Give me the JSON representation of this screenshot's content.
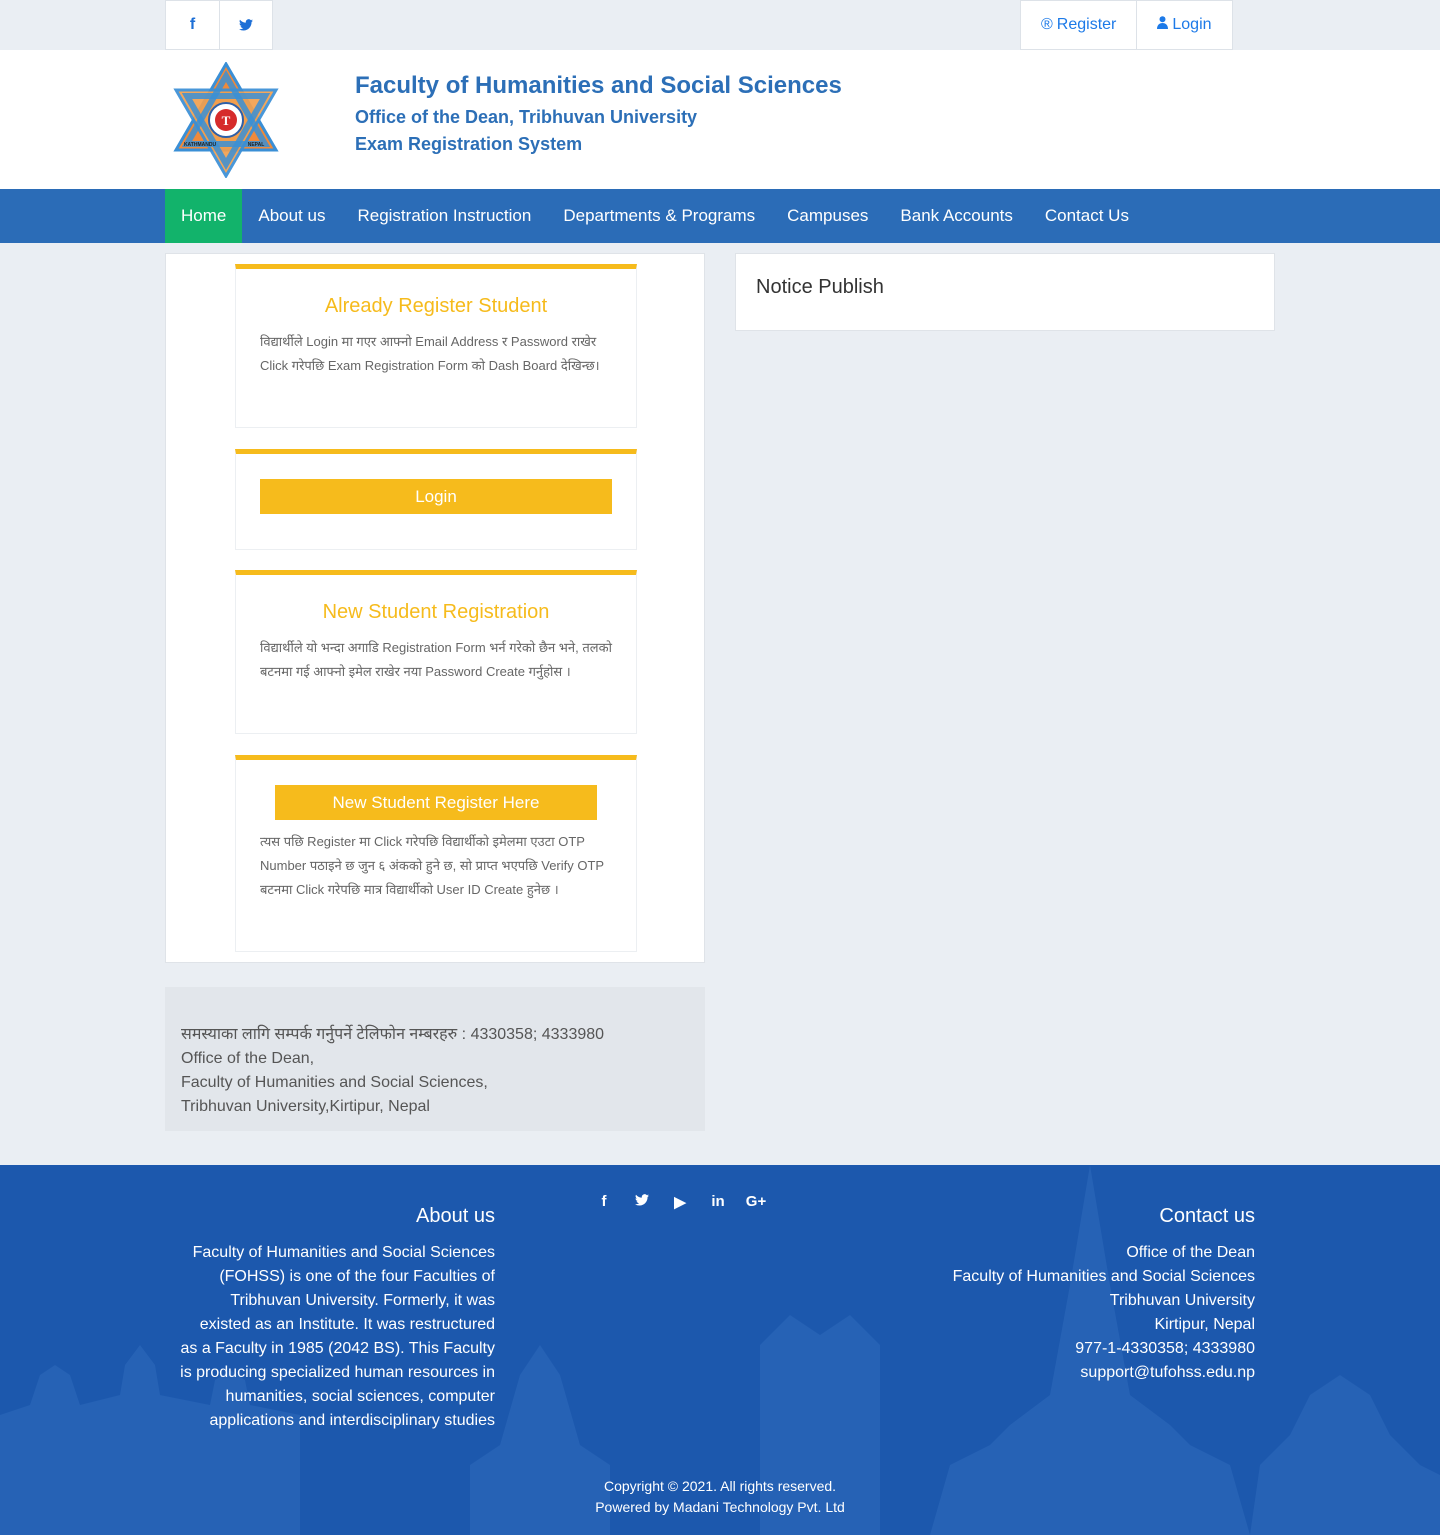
{
  "topbar": {
    "social": [
      {
        "name": "facebook-icon",
        "glyph": "f"
      },
      {
        "name": "twitter-icon",
        "glyph": "t"
      }
    ],
    "register_label": "Register",
    "register_icon": "®",
    "login_label": "Login",
    "login_icon": "user-icon"
  },
  "header": {
    "title": "Faculty of Humanities and Social Sciences",
    "subtitle1": "Office of the Dean, Tribhuvan University",
    "subtitle2": "Exam Registration System",
    "logo_texts": {
      "center": "T",
      "left": "KATHMANDU",
      "right": "NEPAL"
    }
  },
  "nav": {
    "items": [
      "Home",
      "About us",
      "Registration Instruction",
      "Departments & Programs",
      "Campuses",
      "Bank Accounts",
      "Contact Us"
    ],
    "active": "Home"
  },
  "cards": {
    "already": {
      "title": "Already Register Student",
      "text": "विद्यार्थीले Login मा गएर आफ्नो Email Address र Password राखेर Click गरेपछि Exam Registration Form को Dash Board देखिन्छ।"
    },
    "login_button": "Login",
    "new_student": {
      "title": "New Student Registration",
      "text": "विद्यार्थीले यो भन्दा अगाडि Registration Form भर्न गरेको छैन भने, तलको बटनमा गई आफ्नो इमेल राखेर नया Password Create गर्नुहोस ।"
    },
    "register_button": "New Student Register Here",
    "register_text": "त्यस पछि Register मा Click गरेपछि विद्यार्थीको इमेलमा एउटा OTP Number पठाइने छ जुन ६ अंकको हुने छ, सो प्राप्त भएपछि Verify OTP बटनमा Click गरेपछि मात्र विद्यार्थीको User ID Create हुनेछ ।"
  },
  "notice": {
    "title": "Notice Publish"
  },
  "contact_box": {
    "line1": "समस्याका लागि सम्पर्क गर्नुपर्ने टेलिफोन नम्बरहरु : 4330358; 4333980",
    "line2": "Office of the Dean,",
    "line3": "Faculty of Humanities and Social Sciences,",
    "line4": "Tribhuvan University,Kirtipur, Nepal"
  },
  "footer": {
    "about_title": "About us",
    "about_text": "Faculty of Humanities and Social Sciences (FOHSS) is one of the four Faculties of Tribhuvan University. Formerly, it was existed as an Institute. It was restructured as a Faculty in 1985 (2042 BS). This Faculty is producing specialized human resources in humanities, social sciences, computer applications and interdisciplinary studies",
    "social": [
      {
        "name": "facebook-icon",
        "glyph": "f"
      },
      {
        "name": "twitter-icon",
        "glyph": "t"
      },
      {
        "name": "youtube-icon",
        "glyph": "▶"
      },
      {
        "name": "linkedin-icon",
        "glyph": "in"
      },
      {
        "name": "google-plus-icon",
        "glyph": "G+"
      }
    ],
    "contact_title": "Contact us",
    "contact_lines": [
      "Office of the Dean",
      "Faculty of Humanities and Social Sciences",
      "Tribhuvan University",
      "Kirtipur, Nepal",
      "977-1-4330358; 4333980",
      "support@tufohss.edu.np"
    ],
    "copyright": "Copyright © 2021. All rights reserved.",
    "powered": "Powered by Madani Technology Pvt. Ltd"
  },
  "colors": {
    "brand_blue": "#2c6fb7",
    "nav_blue": "#2b6cb7",
    "active_green": "#12b36b",
    "accent_yellow": "#f6bb1c",
    "footer_blue": "#1c58ad"
  }
}
